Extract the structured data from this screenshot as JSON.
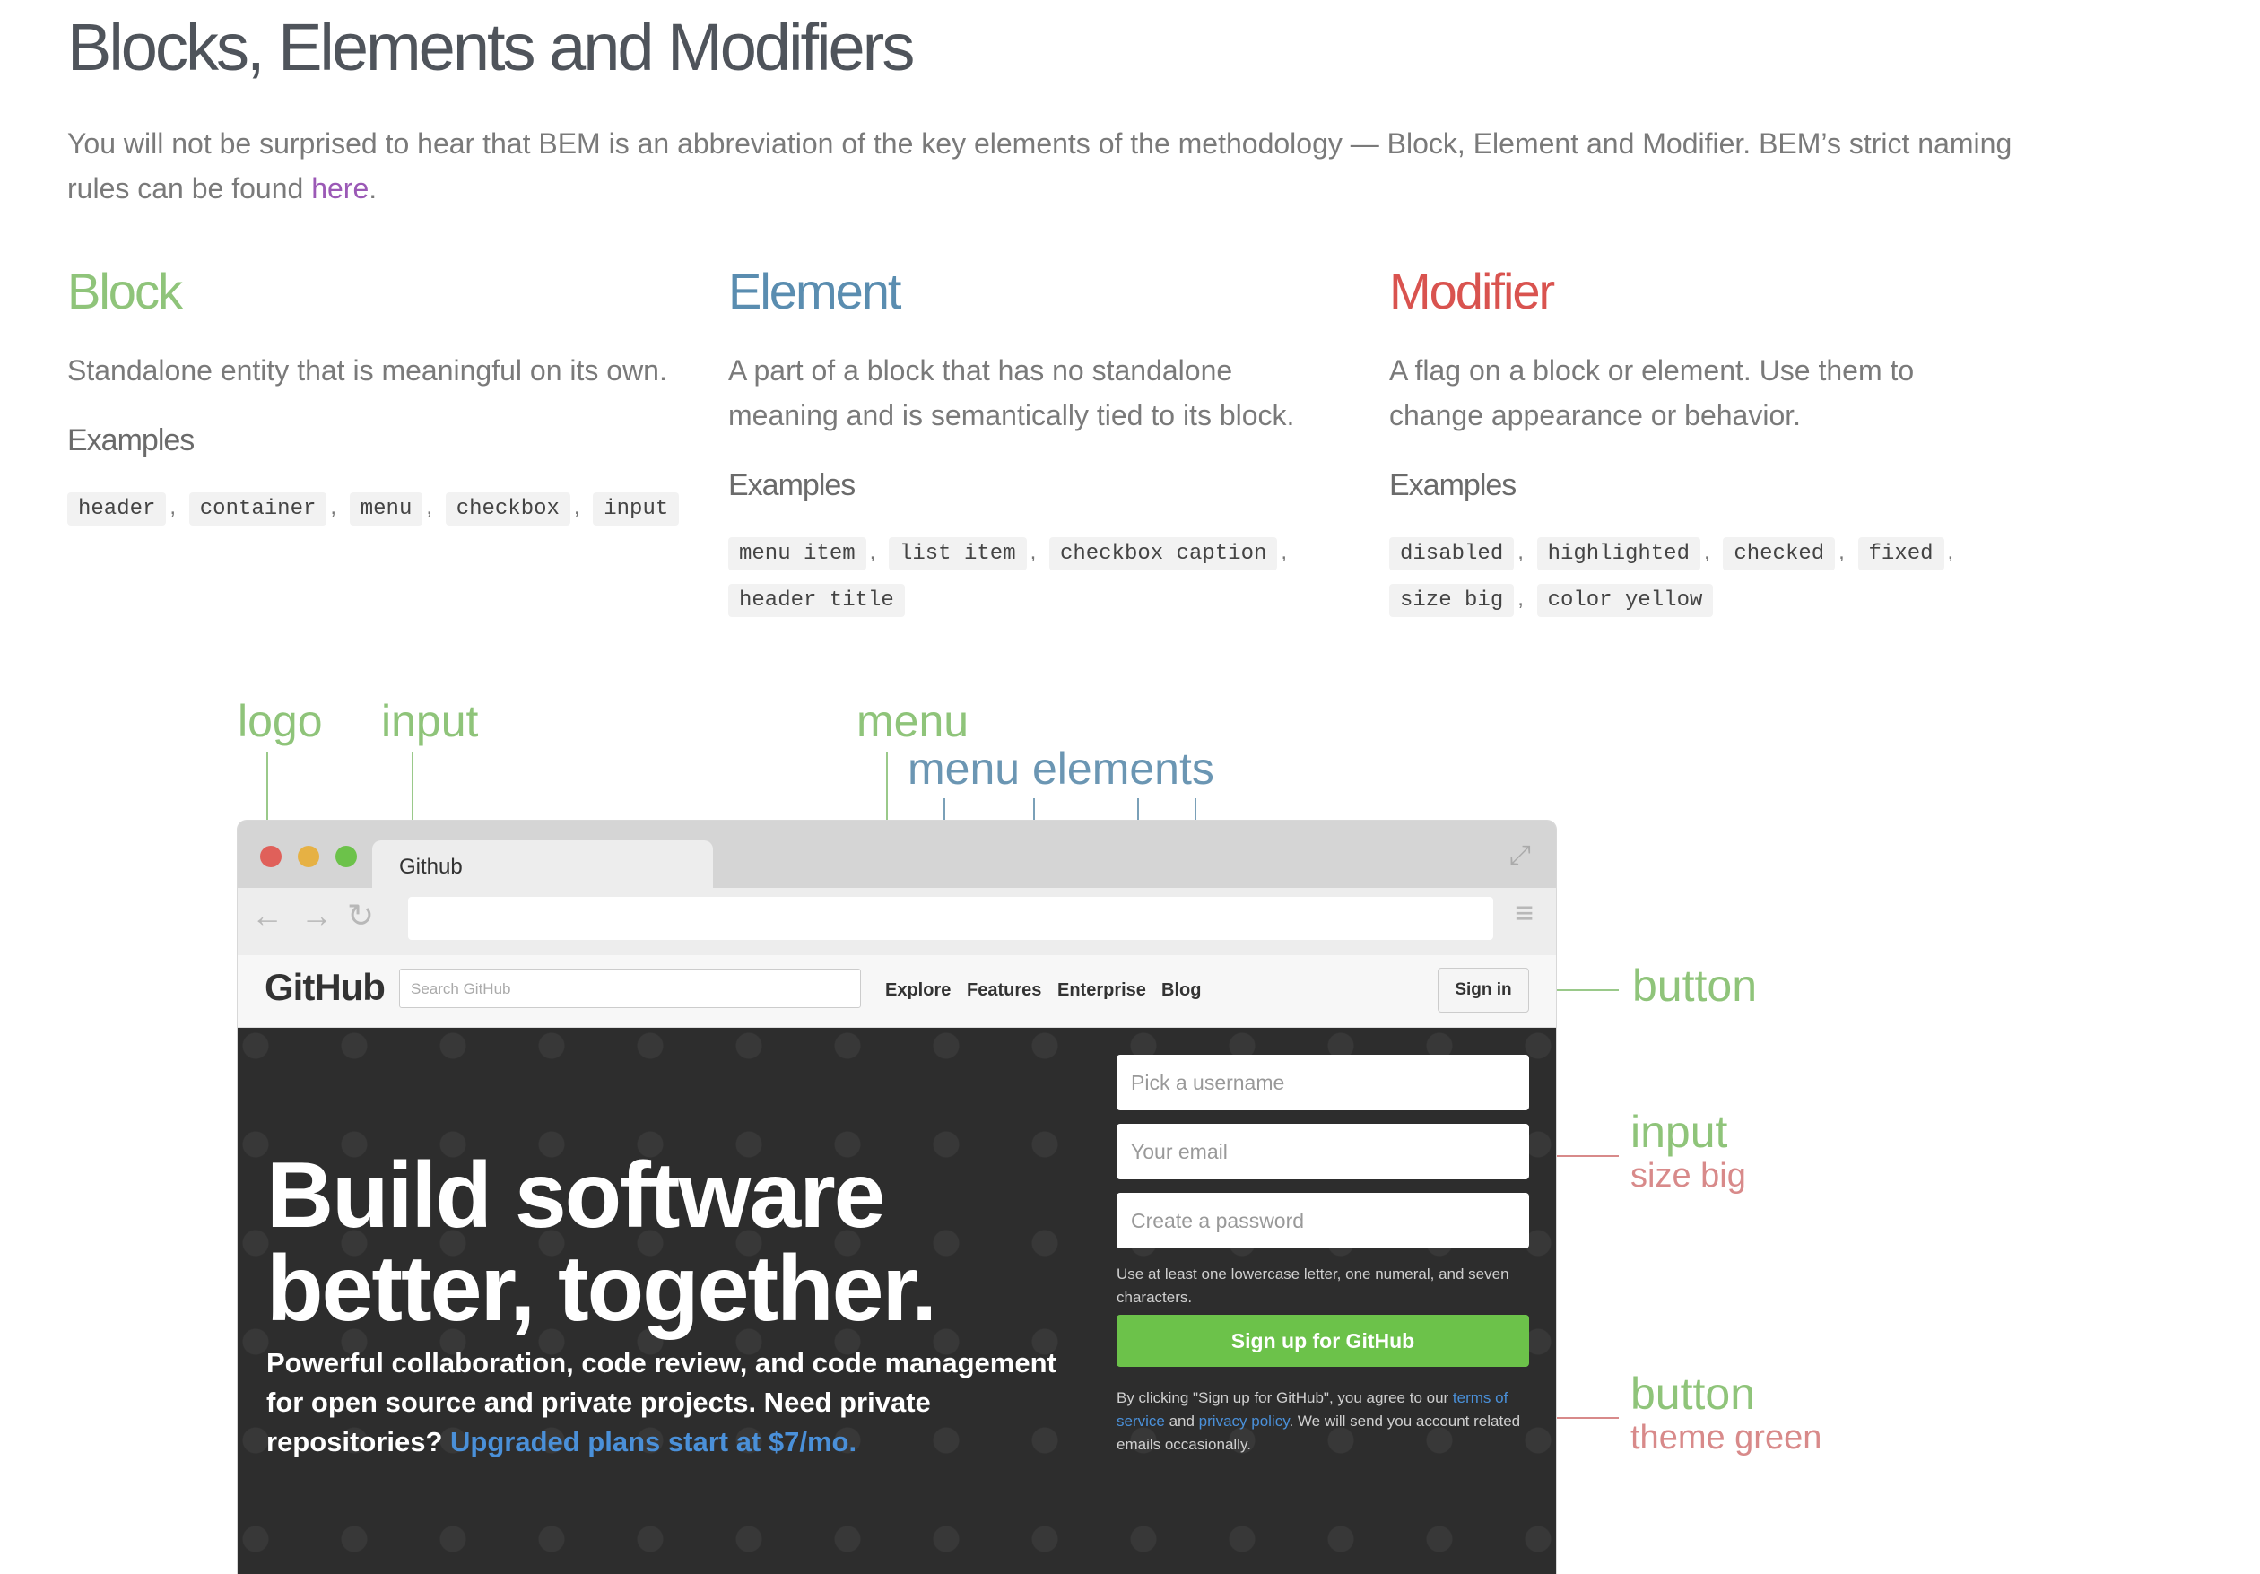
{
  "page": {
    "title": "Blocks, Elements and Modifiers",
    "intro": "You will not be surprised to hear that BEM is an abbreviation of the key elements of the methodology — Block, Element and Modifier. BEM’s strict naming rules can be found ",
    "intro_link": "here",
    "intro_end": "."
  },
  "columns": [
    {
      "title": "Block",
      "color": "#8fc47a",
      "description": "Standalone entity that is meaningful on its own.",
      "examples_title": "Examples",
      "examples": [
        "header",
        "container",
        "menu",
        "checkbox",
        "input"
      ]
    },
    {
      "title": "Element",
      "color": "#5a8db0",
      "description": "A part of a block that has no standalone meaning and is semantically tied to its block.",
      "examples_title": "Examples",
      "examples": [
        "menu item",
        "list item",
        "checkbox caption",
        "header title"
      ]
    },
    {
      "title": "Modifier",
      "color": "#d9534f",
      "description": "A flag on a block or element. Use them to change appearance or behavior.",
      "examples_title": "Examples",
      "examples": [
        "disabled",
        "highlighted",
        "checked",
        "fixed",
        "size big",
        "color yellow"
      ]
    }
  ],
  "annotations": {
    "logo": "logo",
    "input_top": "input",
    "menu": "menu",
    "menu_elements": "menu elements",
    "button_top": "button",
    "input_right": "input",
    "input_modifier": "size big",
    "button_right": "button",
    "button_modifier": "theme green"
  },
  "browser": {
    "tab_title": "Github",
    "dot_colors": [
      "#e0605a",
      "#e6b144",
      "#6cc24a"
    ]
  },
  "github": {
    "logo": "GitHub",
    "search_placeholder": "Search GitHub",
    "menu": [
      "Explore",
      "Features",
      "Enterprise",
      "Blog"
    ],
    "sign_in": "Sign in",
    "hero_title_line1": "Build software",
    "hero_title_line2": "better, together.",
    "hero_sub": "Powerful collaboration, code review, and code management for open source and private projects. Need private repositories?",
    "hero_link": "Upgraded plans start at $7/mo.",
    "username_placeholder": "Pick a username",
    "email_placeholder": "Your email",
    "password_placeholder": "Create a password",
    "password_hint": "Use at least one lowercase letter, one numeral, and seven characters.",
    "signup_button": "Sign up for GitHub",
    "terms_prefix": "By clicking \"Sign up for GitHub\", you agree to our ",
    "terms_link": "terms of service",
    "terms_and": " and ",
    "privacy_link": "privacy policy",
    "terms_suffix": ". We will send you account related emails occasionally."
  }
}
